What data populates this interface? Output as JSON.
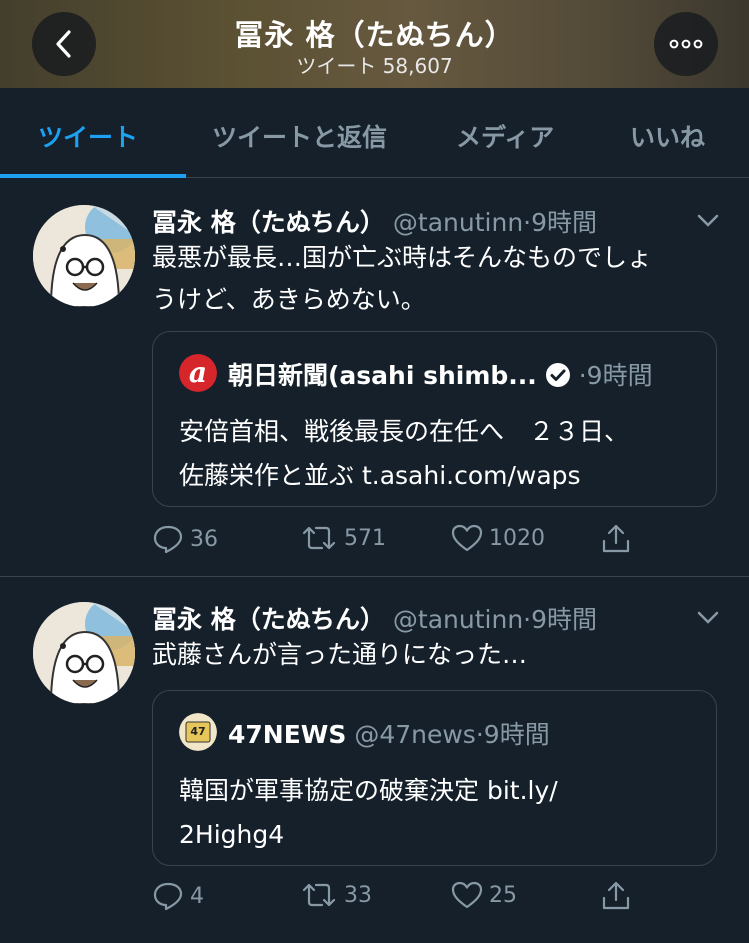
{
  "header": {
    "title": "冨永 格（たぬちん）",
    "subtitle": "ツイート 58,607"
  },
  "tabs": [
    {
      "label": "ツイート"
    },
    {
      "label": "ツイートと返信"
    },
    {
      "label": "メディア"
    },
    {
      "label": "いいね"
    }
  ],
  "tweets": [
    {
      "name": "冨永 格（たぬちん）",
      "handle": "@tanutinn",
      "dot": "·",
      "time": "9時間",
      "text_lines": [
        "最悪が最長…国が亡ぶ時はそんなものでしょ",
        "うけど、あきらめない。"
      ],
      "quote": {
        "name": "朝日新聞(asahi shimb...",
        "dot": "·",
        "time": "9時間",
        "text_lines": [
          "安倍首相、戦後最長の在任へ　２３日、",
          "佐藤栄作と並ぶ t.asahi.com/waps"
        ]
      },
      "replies": "36",
      "retweets": "571",
      "likes": "1020"
    },
    {
      "name": "冨永 格（たぬちん）",
      "handle": "@tanutinn",
      "dot": "·",
      "time": "9時間",
      "text_lines": [
        "武藤さんが言った通りになった…"
      ],
      "quote": {
        "name": "47NEWS",
        "handle": "@47news",
        "dot": "·",
        "time": "9時間",
        "text_lines": [
          "韓国が軍事協定の破棄決定 bit.ly/",
          "2Highg4"
        ]
      },
      "replies": "4",
      "retweets": "33",
      "likes": "25"
    }
  ]
}
